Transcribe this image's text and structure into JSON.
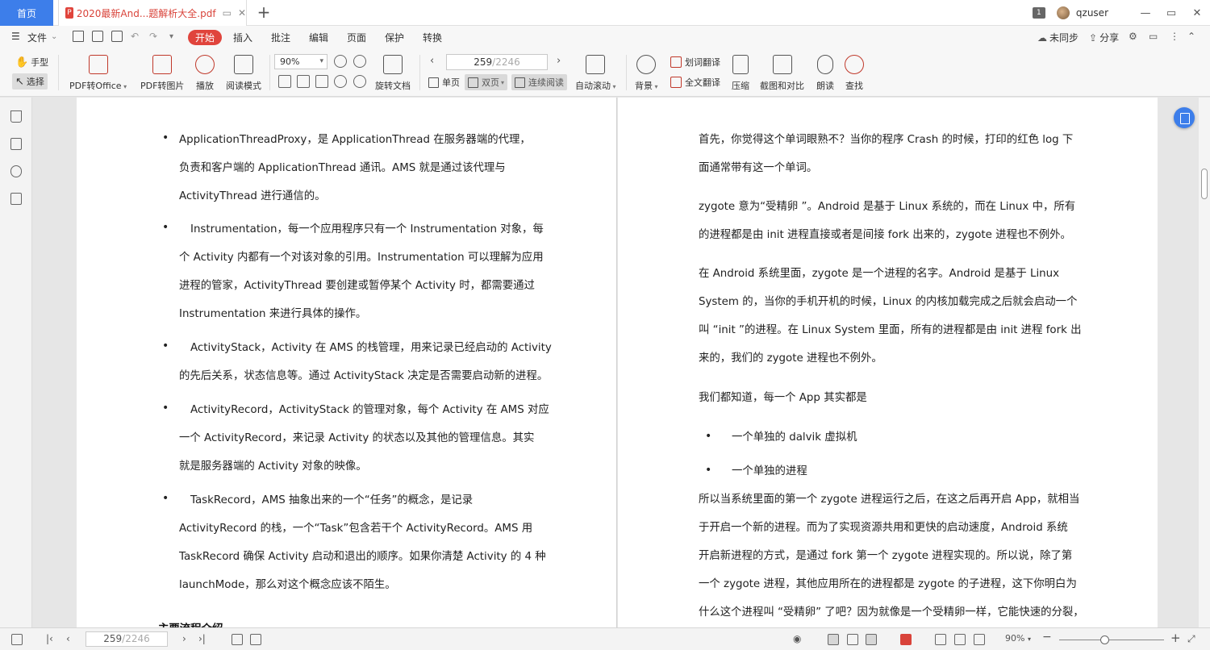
{
  "tabs": {
    "home": "首页",
    "doc_title": "2020最新And...题解析大全.pdf",
    "pdf_badge": "P",
    "add": "+"
  },
  "window": {
    "page_badge": "1",
    "user": "qzuser",
    "min": "—",
    "restore": "▭",
    "close": "✕"
  },
  "menu": {
    "file": "文件",
    "items": [
      "开始",
      "插入",
      "批注",
      "编辑",
      "页面",
      "保护",
      "转换"
    ],
    "sync": "未同步",
    "share": "分享"
  },
  "toolbar": {
    "hand": "手型",
    "select": "选择",
    "pdf_to_office": "PDF转Office",
    "pdf_to_image": "PDF转图片",
    "play": "播放",
    "read_mode": "阅读模式",
    "zoom": "90%",
    "rotate_doc": "旋转文档",
    "page_current": "259",
    "page_total": "/2246",
    "single": "单页",
    "double": "双页",
    "continuous": "连续阅读",
    "auto_scroll": "自动滚动",
    "background": "背景",
    "word_translate": "划词翻译",
    "full_translate": "全文翻译",
    "compress": "压缩",
    "screenshot_compare": "截图和对比",
    "read_aloud": "朗读",
    "find": "查找"
  },
  "left_page": {
    "bullets": [
      [
        "ApplicationThreadProxy，是 ApplicationThread 在服务器端的代理，",
        "负责和客户端的 ApplicationThread 通讯。AMS 就是通过该代理与",
        "ActivityThread 进行通信的。"
      ],
      [
        "Instrumentation，每一个应用程序只有一个 Instrumentation 对象，每",
        "个 Activity 内都有一个对该对象的引用。Instrumentation 可以理解为应用",
        "进程的管家，ActivityThread 要创建或暂停某个 Activity 时，都需要通过",
        "Instrumentation 来进行具体的操作。"
      ],
      [
        "ActivityStack，Activity 在 AMS 的栈管理，用来记录已经启动的 Activity",
        "的先后关系，状态信息等。通过 ActivityStack 决定是否需要启动新的进程。"
      ],
      [
        "ActivityRecord，ActivityStack 的管理对象，每个 Activity 在 AMS 对应",
        "一个 ActivityRecord，来记录 Activity 的状态以及其他的管理信息。其实",
        "就是服务器端的 Activity 对象的映像。"
      ],
      [
        "TaskRecord，AMS 抽象出来的一个“任务”的概念，是记录",
        "ActivityRecord 的栈，一个“Task”包含若干个 ActivityRecord。AMS 用",
        "TaskRecord 确保 Activity 启动和退出的顺序。如果你清楚 Activity 的 4 种",
        "launchMode，那么对这个概念应该不陌生。"
      ]
    ],
    "heading": "主要流程介绍"
  },
  "right_page": {
    "p1": [
      "首先，你觉得这个单词眼熟不？当你的程序 Crash 的时候，打印的红色 log 下",
      "面通常带有这一个单词。"
    ],
    "p2": [
      "zygote 意为“受精卵 ”。Android 是基于 Linux 系统的，而在 Linux 中，所有",
      "的进程都是由 init 进程直接或者是间接 fork 出来的，zygote 进程也不例外。"
    ],
    "p3": [
      "在 Android 系统里面，zygote 是一个进程的名字。Android 是基于 Linux",
      "System 的，当你的手机开机的时候，Linux 的内核加载完成之后就会启动一个",
      "叫 “init ”的进程。在 Linux System 里面，所有的进程都是由 init 进程 fork 出",
      "来的，我们的 zygote 进程也不例外。"
    ],
    "p4": "我们都知道，每一个 App 其实都是",
    "bullets": [
      "一个单独的 dalvik 虚拟机",
      "一个单独的进程"
    ],
    "p5": [
      "所以当系统里面的第一个 zygote 进程运行之后，在这之后再开启 App，就相当",
      "于开启一个新的进程。而为了实现资源共用和更快的启动速度，Android 系统",
      "开启新进程的方式，是通过 fork 第一个 zygote 进程实现的。所以说，除了第",
      "一个 zygote 进程，其他应用所在的进程都是 zygote 的子进程，这下你明白为",
      "什么这个进程叫 “受精卵” 了吧？因为就像是一个受精卵一样，它能快速的分裂，"
    ]
  },
  "statusbar": {
    "page_current": "259",
    "page_total": "/2246",
    "zoom": "90%",
    "minus": "−",
    "plus": "+"
  },
  "colors": {
    "accent_blue": "#3d7eea",
    "accent_red": "#e0443c"
  }
}
